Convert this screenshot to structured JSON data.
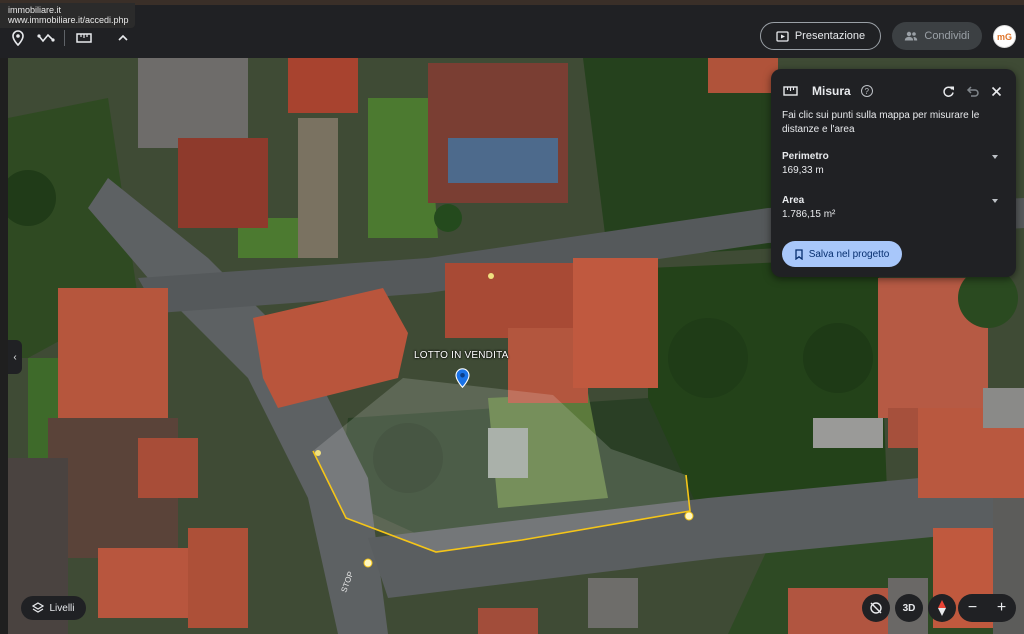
{
  "browser": {
    "tooltip_line1": "immobiliare.it",
    "tooltip_line2": "www.immobiliare.it/accedi.php"
  },
  "toolbar": {
    "icons": [
      "location-pin-icon",
      "path-icon",
      "ruler-icon",
      "chevron-up-icon"
    ],
    "present_label": "Presentazione",
    "share_label": "Condividi",
    "avatar_text": "mG"
  },
  "measure_panel": {
    "title": "Misura",
    "description": "Fai clic sui punti sulla mappa per misurare le distanze e l'area",
    "perimeter_label": "Perimetro",
    "perimeter_value": "169,33 m",
    "area_label": "Area",
    "area_value": "1.786,15 m²",
    "save_label": "Salva nel progetto"
  },
  "map": {
    "lot_label": "LOTTO IN VENDITA",
    "measure_color": "#f5c518",
    "polygon_fill": "rgba(255,255,255,0.18)"
  },
  "bottom_controls": {
    "layers_label": "Livelli",
    "view_3d_label": "3D",
    "zoom_out": "−",
    "zoom_in": "+"
  },
  "colors": {
    "accent": "#a8c7fa",
    "panel_bg": "#202124",
    "roof": "#b5533c"
  }
}
